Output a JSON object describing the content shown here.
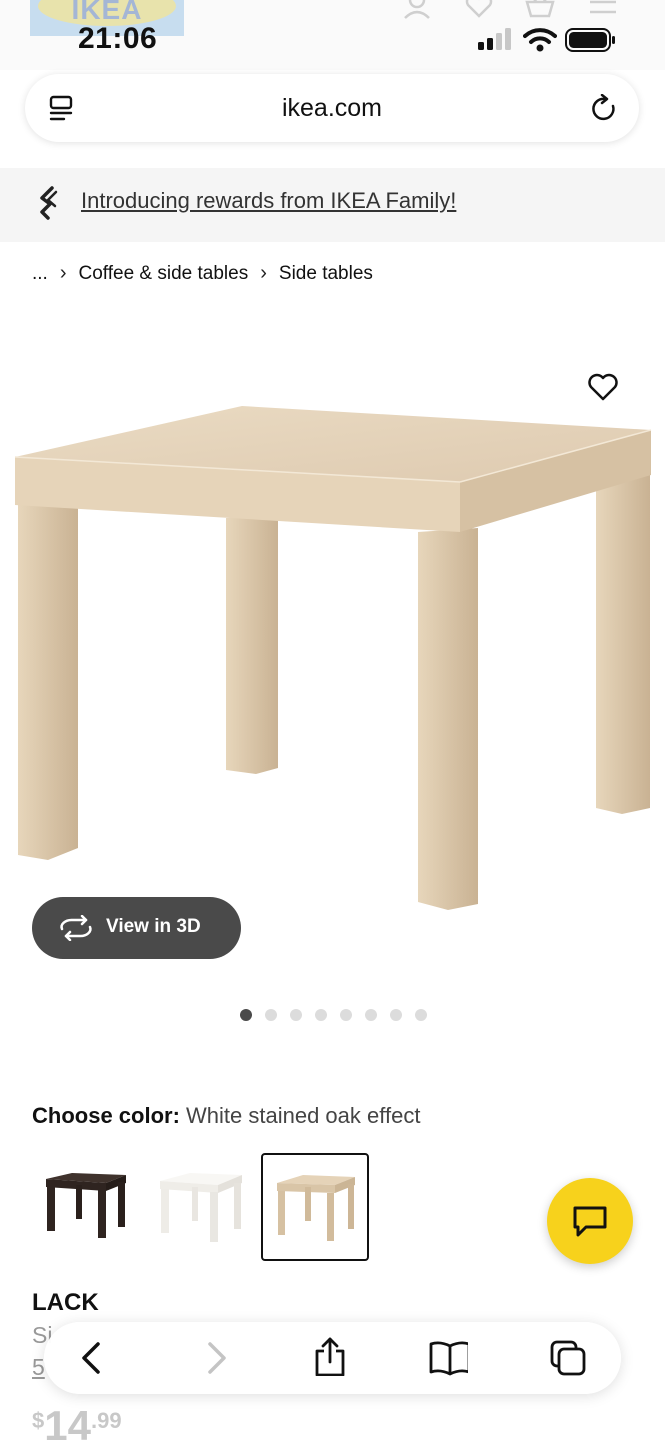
{
  "status_bar": {
    "time": "21:06",
    "logo_text": "IKEA"
  },
  "browser": {
    "url": "ikea.com"
  },
  "promo": {
    "text": "Introducing rewards from IKEA Family!"
  },
  "breadcrumb": {
    "items": [
      "...",
      "Coffee & side tables",
      "Side tables"
    ]
  },
  "gallery": {
    "view_3d_label": "View in 3D",
    "dot_count": 8,
    "active_index": 0
  },
  "color_picker": {
    "label": "Choose color:",
    "selected": "White stained oak effect",
    "options": [
      {
        "name": "black-brown",
        "color": "#3b2e29"
      },
      {
        "name": "white",
        "color": "#f4f2ee"
      },
      {
        "name": "white stained oak effect",
        "color": "#dccab0"
      }
    ]
  },
  "product": {
    "name": "LACK",
    "subtitle": "Si",
    "size": "5",
    "price_currency": "$",
    "price_whole": "14",
    "price_decimal": ".99"
  },
  "colors": {
    "accent_yellow": "#f7d21c",
    "button_dark": "#4a4a4a",
    "table_wood": "#e2cfb3"
  }
}
